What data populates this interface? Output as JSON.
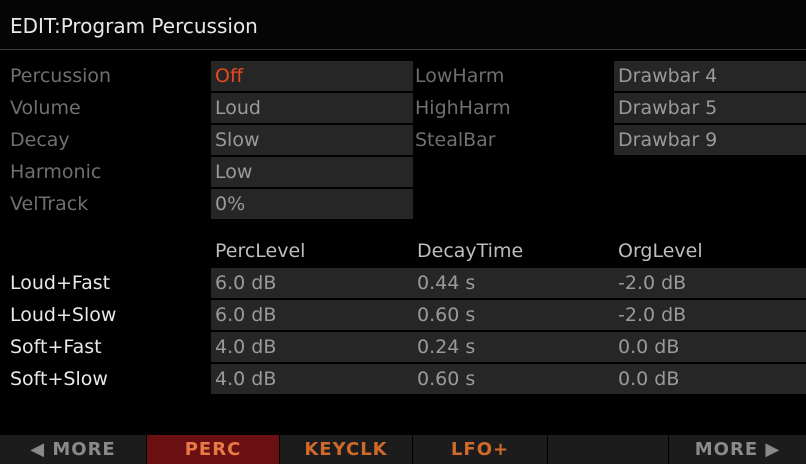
{
  "title": "EDIT:Program Percussion",
  "params_left": [
    {
      "label": "Percussion",
      "value": "Off"
    },
    {
      "label": "Volume",
      "value": "Loud"
    },
    {
      "label": "Decay",
      "value": "Slow"
    },
    {
      "label": "Harmonic",
      "value": "Low"
    },
    {
      "label": "VelTrack",
      "value": "0%"
    }
  ],
  "params_right": [
    {
      "label": "LowHarm",
      "value": "Drawbar 4"
    },
    {
      "label": "HighHarm",
      "value": "Drawbar 5"
    },
    {
      "label": "StealBar",
      "value": "Drawbar 9"
    }
  ],
  "table": {
    "headers": [
      "PercLevel",
      "DecayTime",
      "OrgLevel"
    ],
    "rows": [
      {
        "label": "Loud+Fast",
        "cells": [
          "6.0 dB",
          "0.44 s",
          "-2.0 dB"
        ]
      },
      {
        "label": "Loud+Slow",
        "cells": [
          "6.0 dB",
          "0.60 s",
          "-2.0 dB"
        ]
      },
      {
        "label": "Soft+Fast",
        "cells": [
          "4.0 dB",
          "0.24 s",
          "0.0 dB"
        ]
      },
      {
        "label": "Soft+Slow",
        "cells": [
          "4.0 dB",
          "0.60 s",
          "0.0 dB"
        ]
      }
    ]
  },
  "softkeys": {
    "more_left": "◀ MORE",
    "perc": "PERC",
    "keyclk": "KEYCLK",
    "lfo": "LFO+",
    "more_right": "MORE ▶"
  },
  "colors": {
    "highlight": "#e8491d",
    "selected_tab_bg": "#6a0f12"
  }
}
